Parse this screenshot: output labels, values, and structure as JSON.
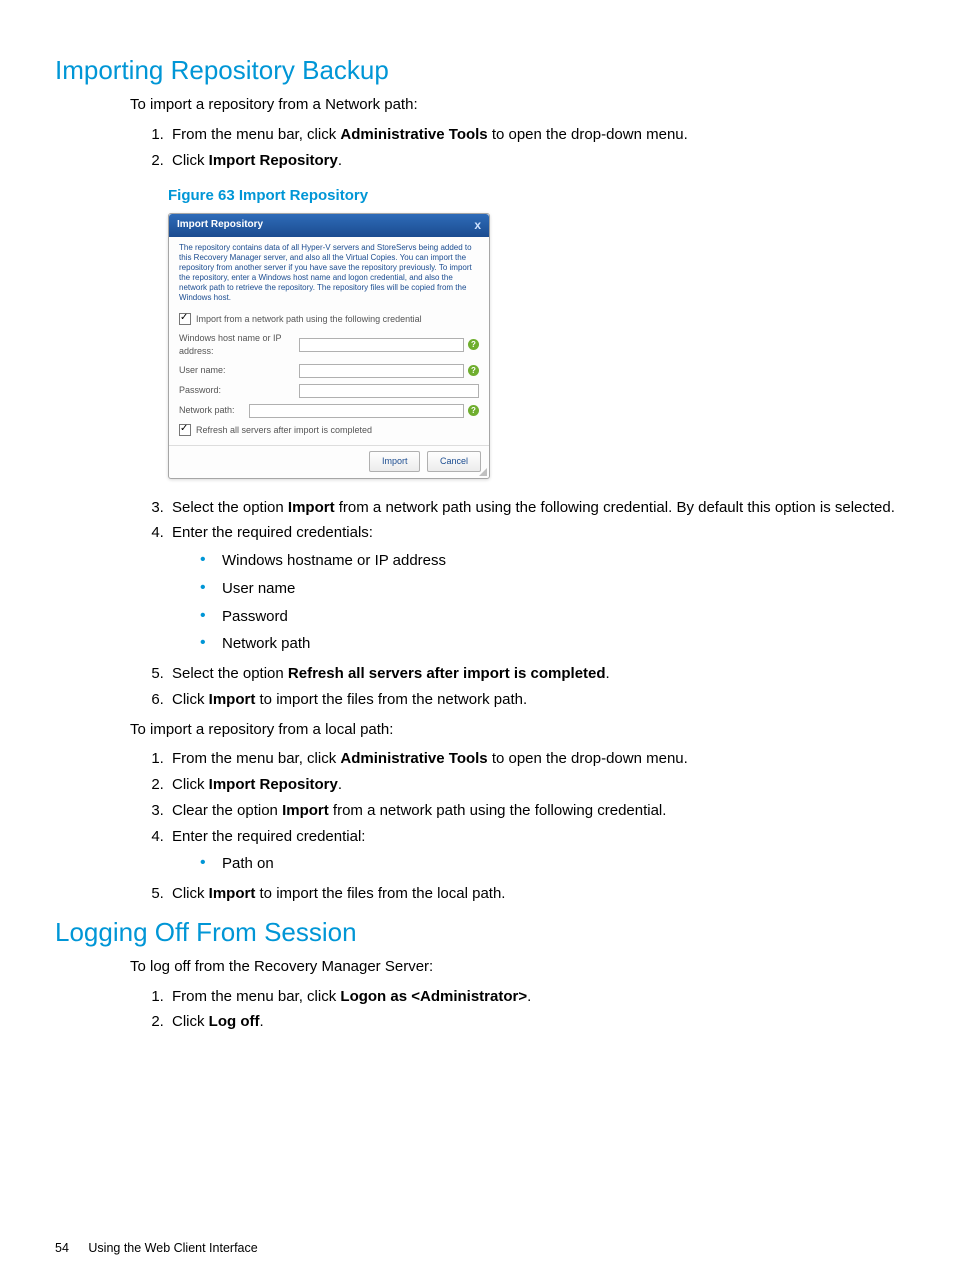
{
  "section1": {
    "heading": "Importing Repository Backup",
    "intro": "To import a repository from a Network path:",
    "step1a": "From the menu bar, click ",
    "step1b": "Administrative Tools",
    "step1c": " to open the drop-down menu.",
    "step2a": "Click ",
    "step2b": "Import Repository",
    "step2c": ".",
    "figcap": "Figure 63 Import Repository",
    "step3a": "Select the option ",
    "step3b": "Import",
    "step3c": " from a network path using the following credential. By default this option is selected.",
    "step4": "Enter the required credentials:",
    "cred1": "Windows hostname or IP address",
    "cred2": "User name",
    "cred3": "Password",
    "cred4": "Network path",
    "step5a": "Select the option ",
    "step5b": "Refresh all servers after import is completed",
    "step5c": ".",
    "step6a": "Click ",
    "step6b": "Import",
    "step6c": " to import the files from the network path.",
    "localintro": "To import a repository from a local path:",
    "lstep1a": "From the menu bar, click ",
    "lstep1b": "Administrative Tools",
    "lstep1c": " to open the drop-down menu.",
    "lstep2a": "Click ",
    "lstep2b": "Import Repository",
    "lstep2c": ".",
    "lstep3a": "Clear the option ",
    "lstep3b": "Import",
    "lstep3c": " from a network path using the following credential.",
    "lstep4": "Enter the required credential:",
    "lcred1": "Path on",
    "lstep5a": "Click ",
    "lstep5b": "Import",
    "lstep5c": " to import the files from the local path."
  },
  "dialog": {
    "title": "Import Repository",
    "close": "x",
    "desc": "The repository contains data of all Hyper-V servers and StoreServs being added to this Recovery Manager server, and also all the Virtual Copies. You can import the repository from another server if you have save the repository previously. To import the repository, enter a Windows host name and logon credential, and also the network path to retrieve the repository. The repository files will be copied from the Windows host.",
    "chk1": "Import from a network path using the following credential",
    "lbl_host": "Windows host name or IP address:",
    "lbl_user": "User name:",
    "lbl_pass": "Password:",
    "lbl_path": "Network path:",
    "chk2": "Refresh all servers after import is completed",
    "btn_import": "Import",
    "btn_cancel": "Cancel",
    "help": "?"
  },
  "section2": {
    "heading": "Logging Off From Session",
    "intro": "To log off from the Recovery Manager Server:",
    "step1a": "From the menu bar, click ",
    "step1b": "Logon as <Administrator>",
    "step1c": ".",
    "step2a": "Click ",
    "step2b": "Log off",
    "step2c": "."
  },
  "footer": {
    "pagenum": "54",
    "title": "Using the Web Client Interface"
  }
}
